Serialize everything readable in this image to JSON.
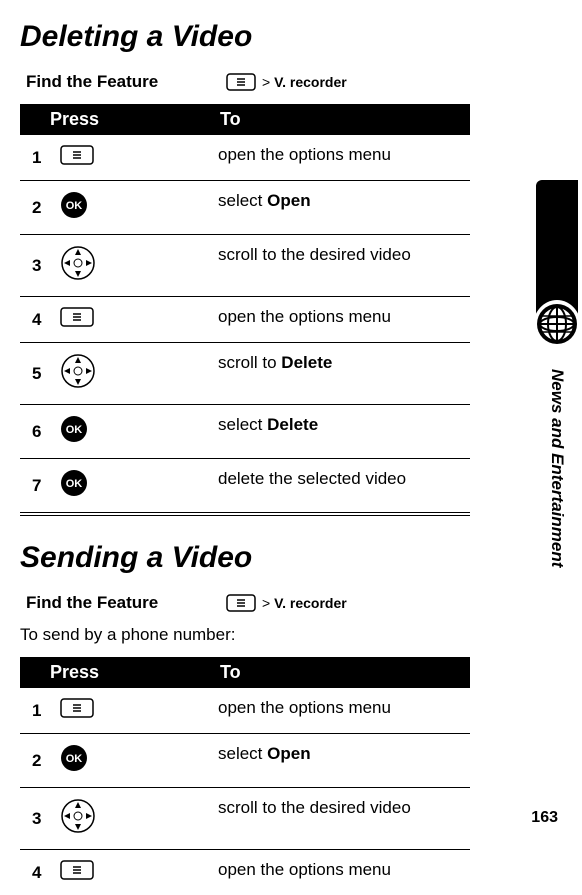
{
  "section_title": "News and Entertainment",
  "page_number": "163",
  "deleting": {
    "heading": "Deleting a Video",
    "find_label": "Find the Feature",
    "menu_path_sep": ">",
    "menu_path_item": "V. recorder",
    "table_header_press": "Press",
    "table_header_to": "To",
    "steps": {
      "1": {
        "num": "1",
        "action": "open the options menu"
      },
      "2": {
        "num": "2",
        "action_prefix": "select ",
        "action_bold": "Open"
      },
      "3": {
        "num": "3",
        "action": "scroll to the desired video"
      },
      "4": {
        "num": "4",
        "action": "open the options menu"
      },
      "5": {
        "num": "5",
        "action_prefix": "scroll to ",
        "action_bold": "Delete"
      },
      "6": {
        "num": "6",
        "action_prefix": "select ",
        "action_bold": "Delete"
      },
      "7": {
        "num": "7",
        "action": "delete the selected video"
      }
    }
  },
  "sending": {
    "heading": "Sending a Video",
    "find_label": "Find the Feature",
    "menu_path_sep": ">",
    "menu_path_item": "V. recorder",
    "body_text": "To send by a phone number:",
    "table_header_press": "Press",
    "table_header_to": "To",
    "steps": {
      "1": {
        "num": "1",
        "action": "open the options menu"
      },
      "2": {
        "num": "2",
        "action_prefix": "select ",
        "action_bold": "Open"
      },
      "3": {
        "num": "3",
        "action": "scroll to the desired video"
      },
      "4": {
        "num": "4",
        "action": "open the options menu"
      }
    }
  }
}
